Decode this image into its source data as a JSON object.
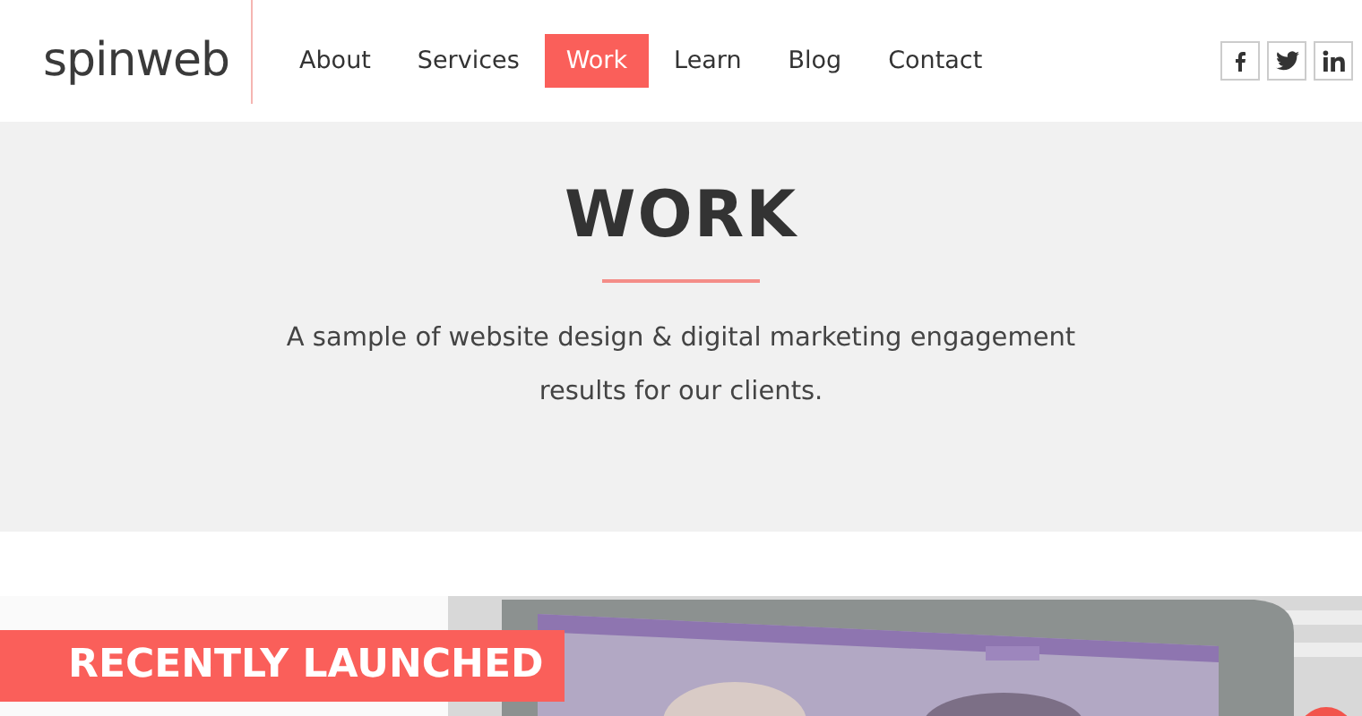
{
  "header": {
    "logo": "spinweb",
    "nav": [
      {
        "label": "About",
        "selected": false
      },
      {
        "label": "Services",
        "selected": false
      },
      {
        "label": "Work",
        "selected": true
      },
      {
        "label": "Learn",
        "selected": false
      },
      {
        "label": "Blog",
        "selected": false
      },
      {
        "label": "Contact",
        "selected": false
      }
    ],
    "social": [
      {
        "kind": "facebook"
      },
      {
        "kind": "twitter"
      },
      {
        "kind": "linkedin"
      }
    ]
  },
  "hero": {
    "title": "WORK",
    "subtitle": "A sample of website design & digital marketing engagement results for our clients."
  },
  "showcase": {
    "badge": "RECENTLY LAUNCHED"
  }
}
